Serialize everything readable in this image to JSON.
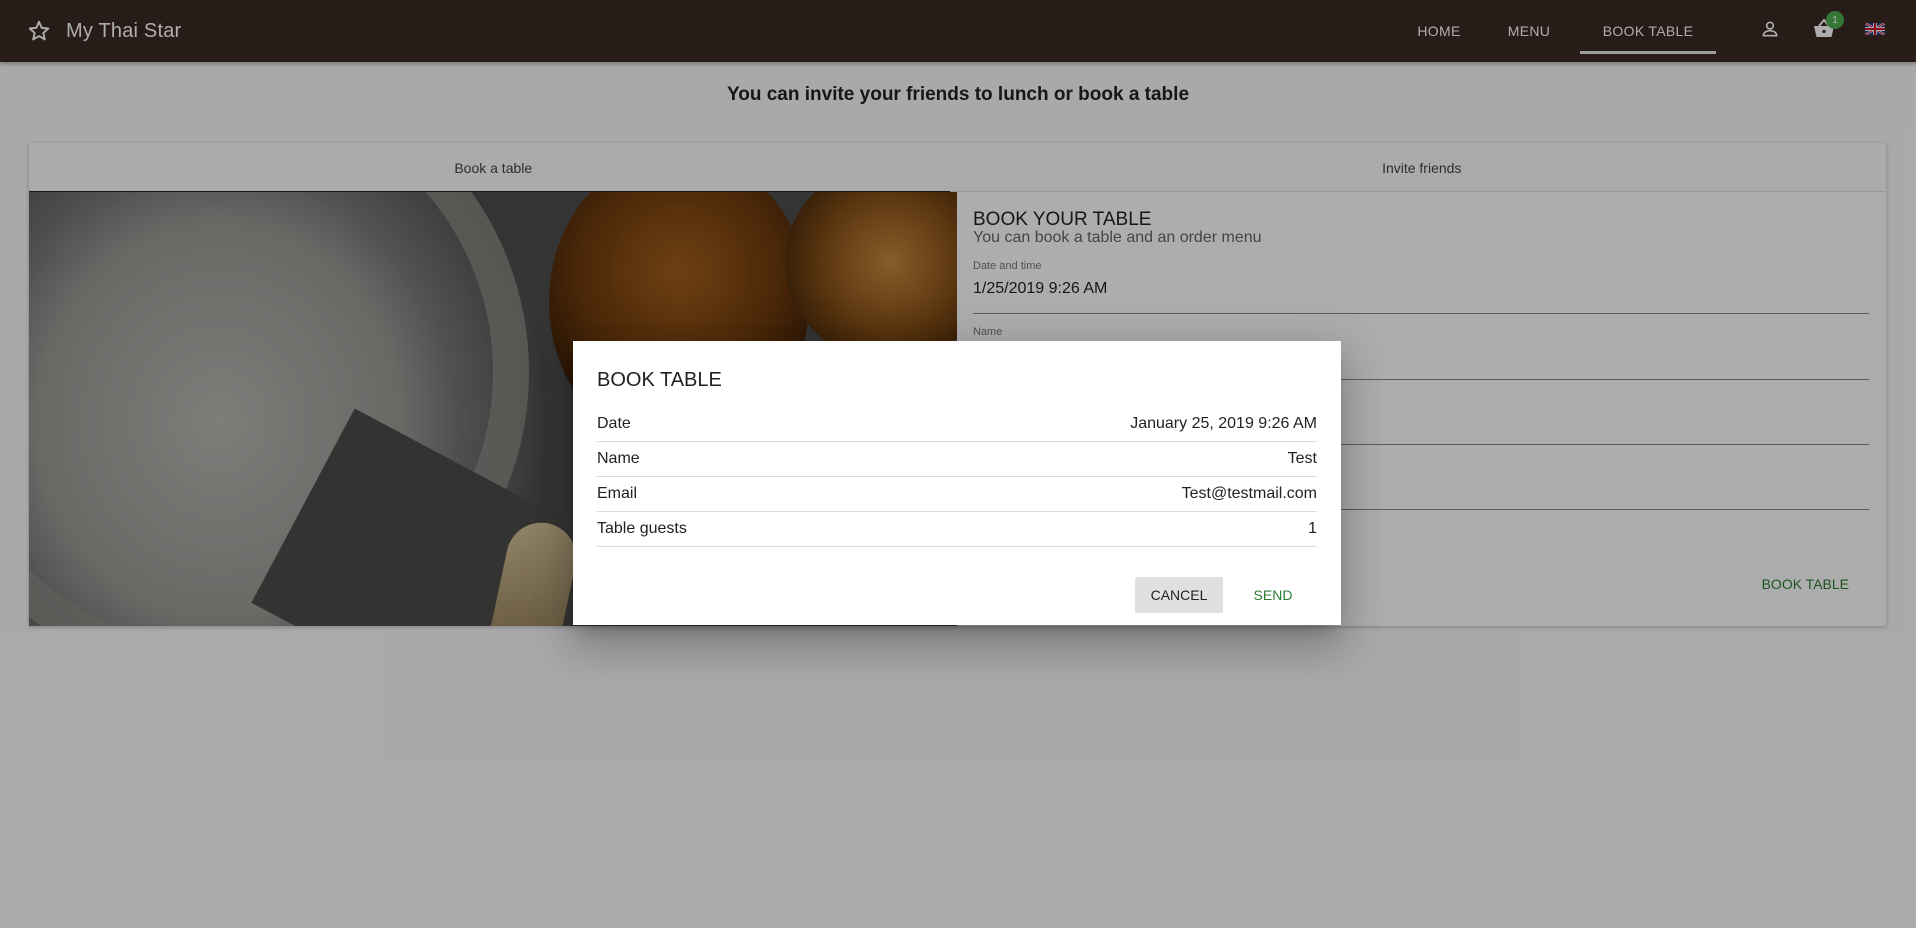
{
  "app": {
    "title": "My Thai Star",
    "nav": {
      "home": "HOME",
      "menu": "MENU",
      "book_table": "BOOK TABLE"
    },
    "cart_count": "1",
    "accent": "#3b2a24"
  },
  "page": {
    "heading": "You can invite your friends to lunch or book a table",
    "tabs": [
      "Book a table",
      "Invite friends"
    ],
    "form": {
      "title": "BOOK YOUR TABLE",
      "subtitle": "You can book a table and an order menu",
      "date_label": "Date and time",
      "date_value": "1/25/2019 9:26 AM",
      "name_label": "Name",
      "book_button": "BOOK TABLE"
    }
  },
  "dialog": {
    "title": "BOOK TABLE",
    "rows": [
      {
        "label": "Date",
        "value": "January 25, 2019 9:26 AM"
      },
      {
        "label": "Name",
        "value": "Test"
      },
      {
        "label": "Email",
        "value": "Test@testmail.com"
      },
      {
        "label": "Table guests",
        "value": "1"
      }
    ],
    "cancel": "CANCEL",
    "send": "SEND"
  },
  "icons": [
    "star-icon",
    "person-icon",
    "cart-icon",
    "uk-flag-icon"
  ]
}
